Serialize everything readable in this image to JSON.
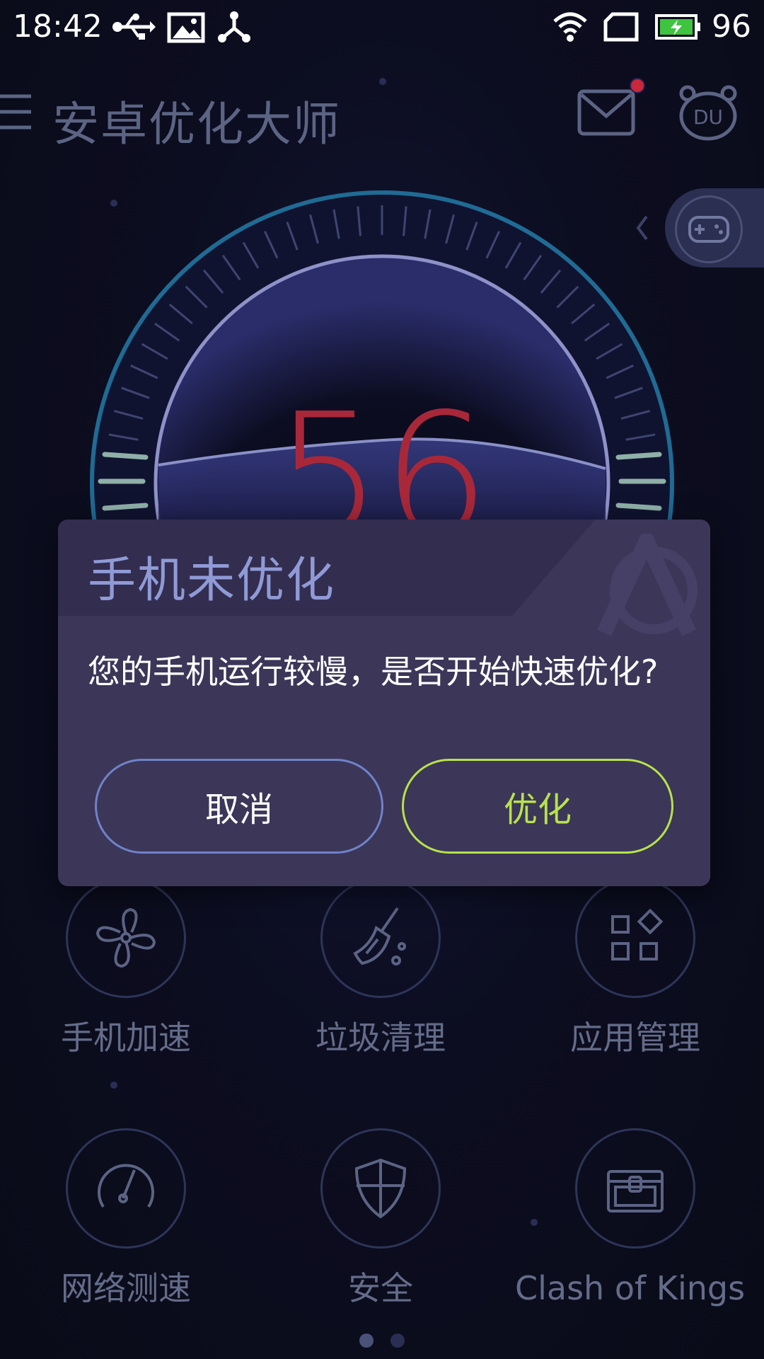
{
  "status_bar": {
    "time": "18:42",
    "battery_level": "96",
    "icons": [
      "usb-icon",
      "image-icon",
      "share-icon",
      "wifi-icon",
      "sim-icon",
      "battery-charging-icon"
    ]
  },
  "app_bar": {
    "title": "安卓优化大师",
    "mail_has_notification": true,
    "du_label": "DU"
  },
  "gauge": {
    "score": "56"
  },
  "dialog": {
    "title": "手机未优化",
    "message": "您的手机运行较慢，是否开始快速优化?",
    "cancel_label": "取消",
    "ok_label": "优化"
  },
  "tools": [
    {
      "label": "手机加速",
      "icon": "fan-icon"
    },
    {
      "label": "垃圾清理",
      "icon": "broom-icon"
    },
    {
      "label": "应用管理",
      "icon": "apps-grid-icon"
    },
    {
      "label": "网络测速",
      "icon": "speedometer-icon"
    },
    {
      "label": "安全",
      "icon": "shield-icon"
    },
    {
      "label": "Clash of Kings 惟..",
      "icon": "treasure-chest-icon"
    }
  ],
  "pager": {
    "pages": 2,
    "active": 1
  },
  "colors": {
    "background": "#0c0d1c",
    "dialog_bg": "#3c3659",
    "accent_green": "#b7e34a",
    "cancel_border": "#6f83c8",
    "score_red": "#a8283a",
    "title_blue": "#8f9ad6"
  }
}
